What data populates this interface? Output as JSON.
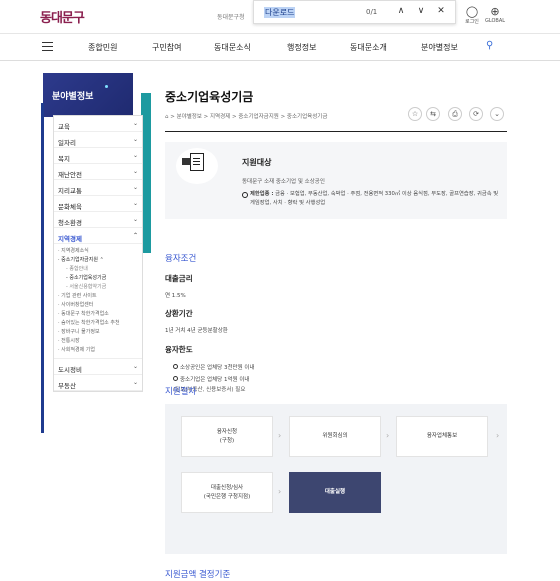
{
  "header": {
    "logo": "동대문구",
    "site_text": "동대문구청",
    "find": {
      "value": "다운로드",
      "count": "0/1",
      "prev": "∧",
      "next": "∨",
      "close": "✕"
    },
    "login_label": "로그인",
    "global_label": "GLOBAL"
  },
  "gnb": {
    "items": [
      "종합민원",
      "구민참여",
      "동대문소식",
      "행정정보",
      "동대문소개",
      "분야별정보"
    ]
  },
  "lnb": {
    "title": "분야별정보",
    "items": [
      {
        "label": "교육",
        "chev": "⌄"
      },
      {
        "label": "일자리",
        "chev": "⌄"
      },
      {
        "label": "복지",
        "chev": "⌄"
      },
      {
        "label": "재난안전",
        "chev": "⌄"
      },
      {
        "label": "지리교통",
        "chev": "⌄"
      },
      {
        "label": "문화체육",
        "chev": "⌄"
      },
      {
        "label": "청소환경",
        "chev": "⌄"
      },
      {
        "label": "지역경제",
        "chev": "⌃"
      }
    ],
    "sub": [
      {
        "label": "· 지역경제소식",
        "cls": ""
      },
      {
        "label": "· 중소기업자금지원",
        "cls": "on",
        "chev": "⌃"
      },
      {
        "label": "- 종합안내",
        "cls": "deep"
      },
      {
        "label": "- 중소기업육성기금",
        "cls": "deep on"
      },
      {
        "label": "- 서울신용협약기금",
        "cls": "deep"
      },
      {
        "label": "· 기업 관련 사이트",
        "cls": ""
      },
      {
        "label": "· 사이버창업센터",
        "cls": ""
      },
      {
        "label": "· 동대문구 착한가격업소",
        "cls": ""
      },
      {
        "label": "· 숨어있는 착한가격업소 추천",
        "cls": ""
      },
      {
        "label": "· 장바구니 물가정보",
        "cls": ""
      },
      {
        "label": "· 전통시장",
        "cls": ""
      },
      {
        "label": "· 사회적경제 기업",
        "cls": ""
      }
    ],
    "bottom": [
      {
        "label": "도시정비",
        "chev": "⌄"
      },
      {
        "label": "부동산",
        "chev": "⌄"
      }
    ]
  },
  "page": {
    "title": "중소기업육성기금",
    "breadcrumb": "⌂  >  분야별정보  >  지역경제  >  중소기업자금지원  >  중소기업육성기금",
    "tools": [
      "☆",
      "⇆",
      "⎙",
      "⟳",
      "⌄"
    ]
  },
  "support": {
    "title": "지원대상",
    "desc": "동대문구 소재 중소기업 및 소상공인",
    "note_label": "제한업종 :",
    "note": "금융 · 보험업, 부동산업, 숙박업 · 주점, 전용면적 330㎡ 이상 음식점, 무도장, 골프연습장, 귀금속 및 게임장업, 사치 · 향락 및 사행성업"
  },
  "loan": {
    "title": "융자조건",
    "rate_title": "대출금리",
    "rate": "연 1.5%",
    "repay_title": "상환기간",
    "repay": "1년 거치 4년 균등분할상환",
    "limit_title": "융자한도",
    "limits": [
      "소상공인은 업체당 3천만원 이내",
      "중소기업은 업체당 1억원 이내"
    ],
    "limit_note": "(담보(부동산, 신용보증서) 필요"
  },
  "procedure": {
    "title": "지원절차",
    "steps": [
      "융자신청\n(구청)",
      "위원회심의",
      "융자업체통보",
      "대출신청/심사\n(국민은행 구청지점)",
      "대출실행"
    ],
    "arrow": "›"
  },
  "next_section": "지원금액 결정기준"
}
